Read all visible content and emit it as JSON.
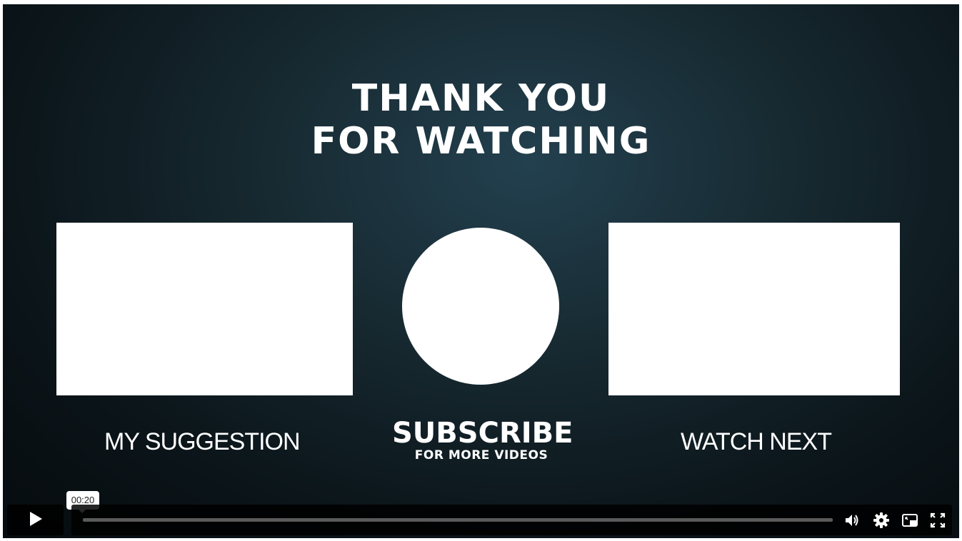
{
  "video": {
    "title_line1": "THANK YOU",
    "title_line2": "FOR WATCHING",
    "left_label": "MY SUGGESTION",
    "right_label": "WATCH NEXT",
    "subscribe_main": "SUBSCRIBE",
    "subscribe_sub": "FOR MORE VIDEOS"
  },
  "controls": {
    "hover_time": "00:20",
    "progress_fraction": 0,
    "icons": [
      "play-icon",
      "volume-icon",
      "settings-icon",
      "picture-in-picture-icon",
      "fullscreen-icon"
    ]
  },
  "colors": {
    "background": "#0b151a",
    "foreground": "#ffffff",
    "control_bg": "#000000"
  }
}
